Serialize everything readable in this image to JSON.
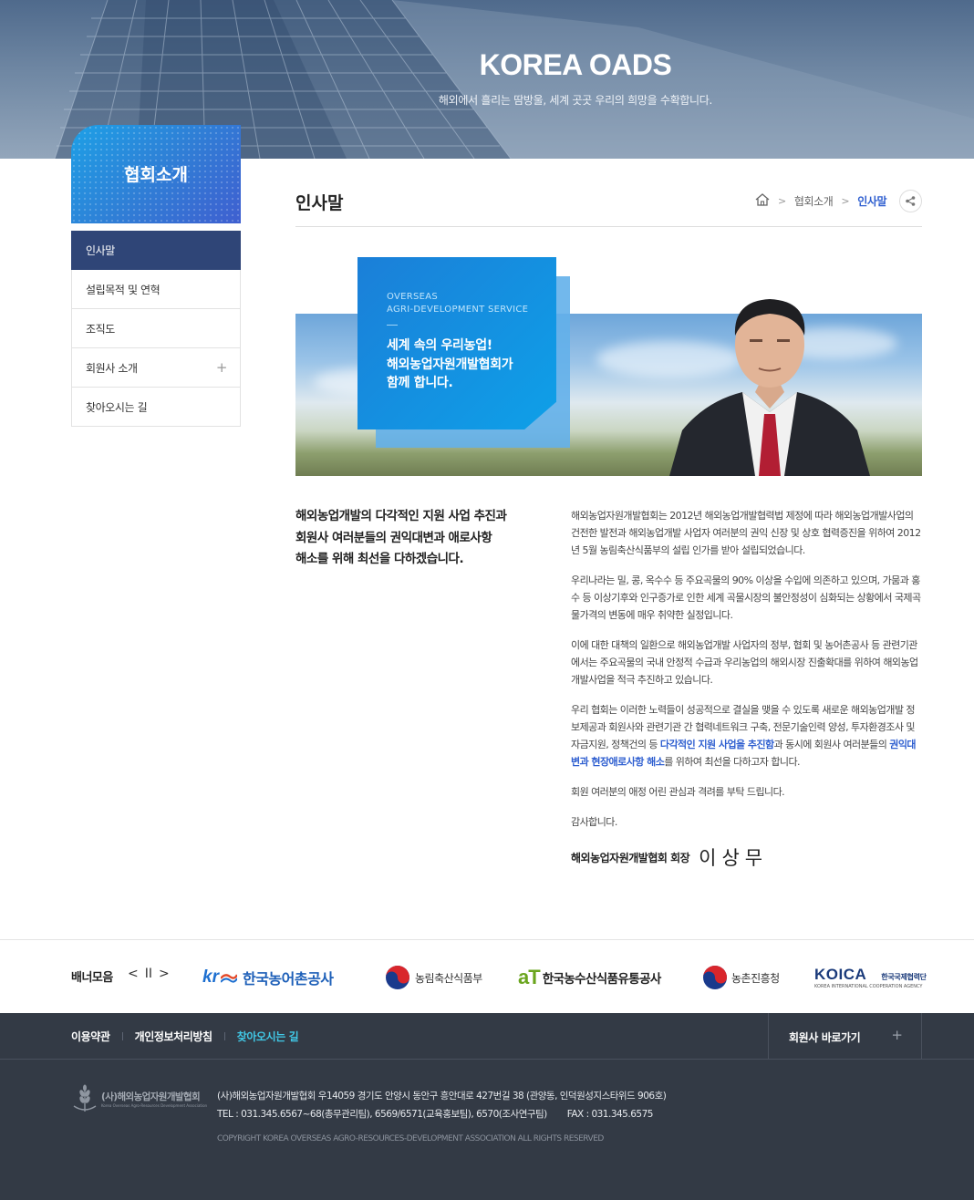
{
  "hero": {
    "title": "KOREA OADS",
    "subtitle": "해외에서 흘리는 땀방울, 세계 곳곳 우리의 희망을 수확합니다."
  },
  "sidebar": {
    "heading": "협회소개",
    "items": [
      {
        "label": "인사말",
        "active": true
      },
      {
        "label": "설립목적 및 연혁"
      },
      {
        "label": "조직도"
      },
      {
        "label": "회원사 소개",
        "expandable": true
      },
      {
        "label": "찾아오시는 길"
      }
    ]
  },
  "page": {
    "title": "인사말",
    "breadcrumb": [
      "협회소개",
      "인사말"
    ]
  },
  "banner": {
    "eng_line1": "OVERSEAS",
    "eng_line2": "AGRI-DEVELOPMENT SERVICE",
    "kor_line1": "세계 속의 우리농업!",
    "kor_line2": "해외농업자원개발협회가",
    "kor_line3": "함께 합니다."
  },
  "lead": {
    "line1": "해외농업개발의 다각적인 지원 사업 추진과",
    "line2": "회원사 여러분들의 권익대변과 애로사항",
    "line3": "해소를 위해 최선을 다하겠습니다."
  },
  "article": {
    "p1": "해외농업자원개발협회는 2012년 해외농업개발협력법 제정에 따라 해외농업개발사업의 건전한 발전과 해외농업개발 사업자 여러분의 권익 신장 및 상호 협력증진을 위하여 2012년 5월 농림축산식품부의 설립 인가를 받아 설립되었습니다.",
    "p2": "우리나라는 밀, 콩, 옥수수 등 주요곡물의 90% 이상을 수입에 의존하고 있으며, 가뭄과 홍수 등 이상기후와 인구증가로 인한 세계 곡물시장의 불안정성이 심화되는 상황에서 국제곡물가격의 변동에 매우 취약한 실정입니다.",
    "p3": "이에 대한 대책의 일환으로 해외농업개발 사업자의 정부, 협회 및 농어촌공사 등 관련기관에서는 주요곡물의 국내 안정적 수급과 우리농업의 해외시장 진출확대를 위하여 해외농업개발사업을 적극 추진하고 있습니다.",
    "p4_a": "우리 협회는 이러한 노력들이 성공적으로 결실을 맺을 수 있도록 새로운 해외농업개발 정보제공과 회원사와 관련기관 간 협력네트워크 구축, 전문기술인력 양성, 투자환경조사 및 자금지원, 정책건의 등 ",
    "p4_hl1": "다각적인 지원 사업을 추진함",
    "p4_b": "과 동시에 회원사 여러분들의 ",
    "p4_hl2": "권익대변과 현장애로사항 해소",
    "p4_c": "를 위하여 최선을 다하고자 합니다.",
    "p5": "회원 여러분의 애정 어린 관심과 격려를 부탁 드립니다.",
    "p6": "감사합니다.",
    "sign_org": "해외농업자원개발협회 회장",
    "sign_name": "이상무"
  },
  "banners": {
    "label": "배너모음",
    "prev": "<",
    "pause": "II",
    "next": ">",
    "items": [
      {
        "name": "한국농어촌공사",
        "mark": "kr"
      },
      {
        "name": "농림축산식품부"
      },
      {
        "name": "한국농수산식품유통공사",
        "mark": "aT"
      },
      {
        "name": "농촌진흥청"
      },
      {
        "name": "KOICA",
        "sub": "한국국제협력단",
        "eng": "KOREA INTERNATIONAL COOPERATION AGENCY"
      }
    ]
  },
  "footer": {
    "links": [
      "이용약관",
      "개인정보처리방침",
      "찾아오시는 길"
    ],
    "family": "회원사 바로가기",
    "logo_text": "(사)해외농업자원개발협회",
    "logo_sub": "Korea Overseas Agro-Resources Development Association",
    "addr1": "(사)해외농업자원개발협회 우14059 경기도 안양시 동안구 흥안대로 427번길 38 (관양동, 인덕원성지스타위드 906호)",
    "tel": "TEL : 031.345.6567~68(총무관리팀), 6569/6571(교육홍보팀), 6570(조사연구팀)",
    "fax": "FAX : 031.345.6575",
    "copyright": "COPYRIGHT KOREA OVERSEAS AGRO-RESOURCES-DEVELOPMENT ASSOCIATION ALL RIGHTS RESERVED"
  },
  "colors": {
    "accent": "#2f5fd0",
    "nav_active": "#2f4577",
    "footer_bg": "#333a45",
    "footer_accent": "#41c8e6"
  }
}
